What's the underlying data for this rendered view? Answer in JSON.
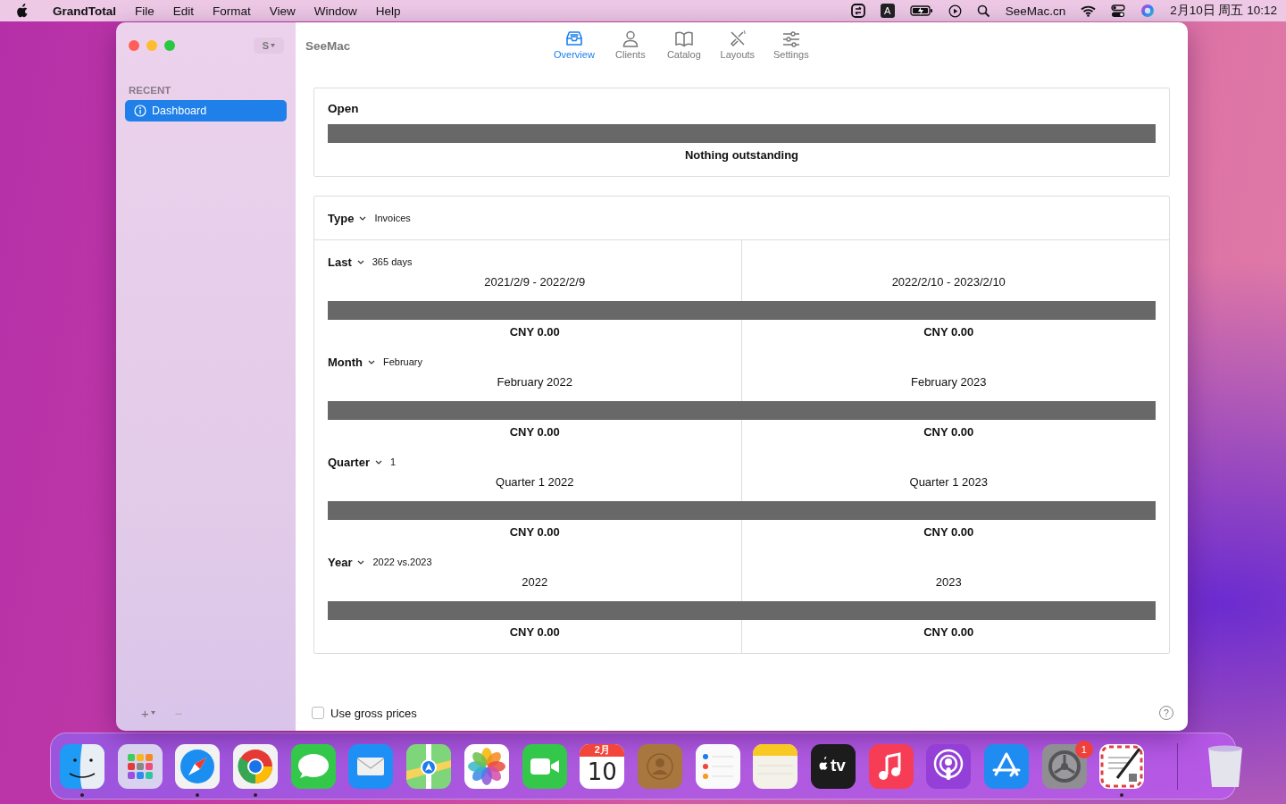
{
  "menubar": {
    "app_name": "GrandTotal",
    "menus": [
      "File",
      "Edit",
      "Format",
      "View",
      "Window",
      "Help"
    ],
    "status_items": [
      {
        "kind": "sync"
      },
      {
        "kind": "input",
        "label": "A"
      },
      {
        "kind": "battery"
      },
      {
        "kind": "play"
      },
      {
        "kind": "search"
      },
      {
        "kind": "text",
        "label": "SeeMac.cn"
      },
      {
        "kind": "wifi"
      },
      {
        "kind": "control"
      },
      {
        "kind": "siri"
      },
      {
        "kind": "text",
        "label": "2月10日 周五  10:12"
      }
    ]
  },
  "window": {
    "title": "SeeMac",
    "account_button": "S",
    "toolbar": [
      {
        "label": "Overview",
        "selected": true
      },
      {
        "label": "Clients",
        "selected": false
      },
      {
        "label": "Catalog",
        "selected": false
      },
      {
        "label": "Layouts",
        "selected": false
      },
      {
        "label": "Settings",
        "selected": false
      }
    ],
    "sidebar": {
      "section": "RECENT",
      "items": [
        {
          "label": "Dashboard",
          "selected": true
        }
      ],
      "add_button": "+",
      "remove_button": "−"
    },
    "open_panel": {
      "title": "Open",
      "message": "Nothing outstanding"
    },
    "type_filter": {
      "label": "Type",
      "value": "Invoices"
    },
    "comparisons": [
      {
        "label": "Last",
        "value": "365 days",
        "periods": [
          {
            "range": "2021/2/9 - 2022/2/9",
            "amount": "CNY 0.00"
          },
          {
            "range": "2022/2/10 - 2023/2/10",
            "amount": "CNY 0.00"
          }
        ]
      },
      {
        "label": "Month",
        "value": "February",
        "periods": [
          {
            "range": "February 2022",
            "amount": "CNY 0.00"
          },
          {
            "range": "February 2023",
            "amount": "CNY 0.00"
          }
        ]
      },
      {
        "label": "Quarter",
        "value": "1",
        "periods": [
          {
            "range": "Quarter 1 2022",
            "amount": "CNY 0.00"
          },
          {
            "range": "Quarter 1 2023",
            "amount": "CNY 0.00"
          }
        ]
      },
      {
        "label": "Year",
        "value": "2022 vs.2023",
        "periods": [
          {
            "range": "2022",
            "amount": "CNY 0.00"
          },
          {
            "range": "2023",
            "amount": "CNY 0.00"
          }
        ]
      }
    ],
    "gross_prices": {
      "label": "Use gross prices",
      "checked": false
    },
    "help_button": "?"
  },
  "dock": {
    "items": [
      {
        "kind": "finder",
        "running": true
      },
      {
        "kind": "launchpad",
        "running": false
      },
      {
        "kind": "safari",
        "running": true
      },
      {
        "kind": "chrome",
        "running": true
      },
      {
        "kind": "messages",
        "running": false
      },
      {
        "kind": "mail",
        "running": false
      },
      {
        "kind": "maps",
        "running": false
      },
      {
        "kind": "photos",
        "running": false
      },
      {
        "kind": "facetime",
        "running": false
      },
      {
        "kind": "calendar",
        "running": false,
        "month": "2月",
        "day": "10"
      },
      {
        "kind": "contacts",
        "running": false
      },
      {
        "kind": "reminders",
        "running": false
      },
      {
        "kind": "notes",
        "running": false
      },
      {
        "kind": "tv",
        "running": false,
        "label": "tv"
      },
      {
        "kind": "music",
        "running": false
      },
      {
        "kind": "podcasts",
        "running": false
      },
      {
        "kind": "appstore",
        "running": false
      },
      {
        "kind": "settings",
        "running": false,
        "badge": "1"
      },
      {
        "kind": "letter",
        "running": true
      }
    ],
    "trash": {
      "kind": "trash"
    }
  }
}
